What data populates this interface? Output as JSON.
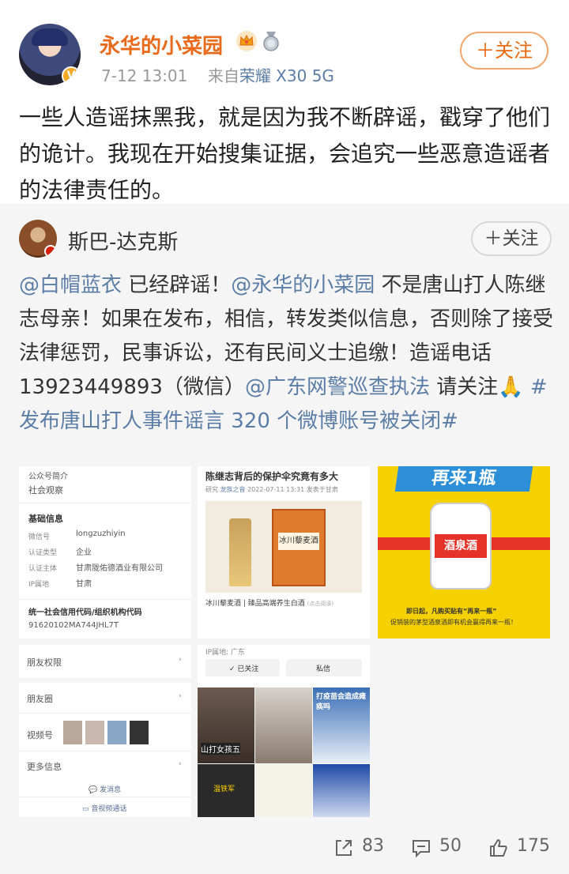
{
  "post": {
    "user_name": "永华的小菜园",
    "time": "7-12 13:01",
    "source_prefix": "来自",
    "device": "荣耀 X30 5G",
    "follow_label": "＋关注",
    "text": "一些人造谣抹黑我，就是因为我不断辟谣，戳穿了他们的诡计。我现在开始搜集证据，会追究一些恶意造谣者的法律责任的。"
  },
  "repost": {
    "user_name": "斯巴-达克斯",
    "follow_label": "＋关注",
    "mention1": "@白帽蓝衣",
    "text1": " 已经辟谣！",
    "mention2": "@永华的小菜园",
    "text2": " 不是唐山打人陈继志母亲！如果在发布，相信，转发类似信息，否则除了接受法律惩罚，民事诉讼，还有民间义士追缴！造谣电话13923449893（微信）",
    "mention3": "@广东网警巡查执法",
    "text3": " 请关注🙏 ",
    "hashtag": "#发布唐山打人事件谣言 320 个微博账号被关闭#"
  },
  "images": {
    "img1": {
      "header": "公众号简介",
      "intro": "社会观察",
      "section": "基础信息",
      "rows": [
        {
          "label": "微信号",
          "value": "longzuzhiyin"
        },
        {
          "label": "认证类型",
          "value": "企业"
        },
        {
          "label": "认证主体",
          "value": "甘肃陇佑德酒业有限公司"
        },
        {
          "label": "IP属地",
          "value": "甘肃"
        }
      ],
      "code_label": "统一社会信用代码/组织机构代码",
      "code_value": "91620102MA744JHL7T"
    },
    "img2": {
      "title": "陈继志背后的保护伞究竟有多大",
      "meta_a": "研究",
      "meta_b": "龙族之音",
      "meta_c": "2022-07-11 13:31",
      "meta_d": "发表于甘肃",
      "box_text": "冰川藜麦酒",
      "caption": "冰川藜麦酒 | 臻品高端养生白酒",
      "caption_tag": "(点击阅读)"
    },
    "img3": {
      "banner": "再来1瓶",
      "label": "酒泉酒",
      "footer1": "即日起，凡购买贴有“再来一瓶”",
      "footer2": "促销装的茅型酒泉酒即有机会赢得再来一瓶！"
    },
    "img4": {
      "items": [
        "朋友权限",
        "朋友圈",
        "视频号",
        "更多信息"
      ],
      "btn1": "发消息",
      "btn2": "音视频通话"
    },
    "img5": {
      "ip": "IP属地: 广东",
      "followed": "✓ 已关注",
      "msg": "私信",
      "tile1": "山打女孩五",
      "tile3": "打疫苗会造成瘫痪吗",
      "tile4": "温铁军"
    }
  },
  "actions": {
    "repost_count": "83",
    "comment_count": "50",
    "like_count": "175"
  },
  "colors": {
    "name_orange": "#e86a1a",
    "link_blue": "#5b7da6"
  }
}
